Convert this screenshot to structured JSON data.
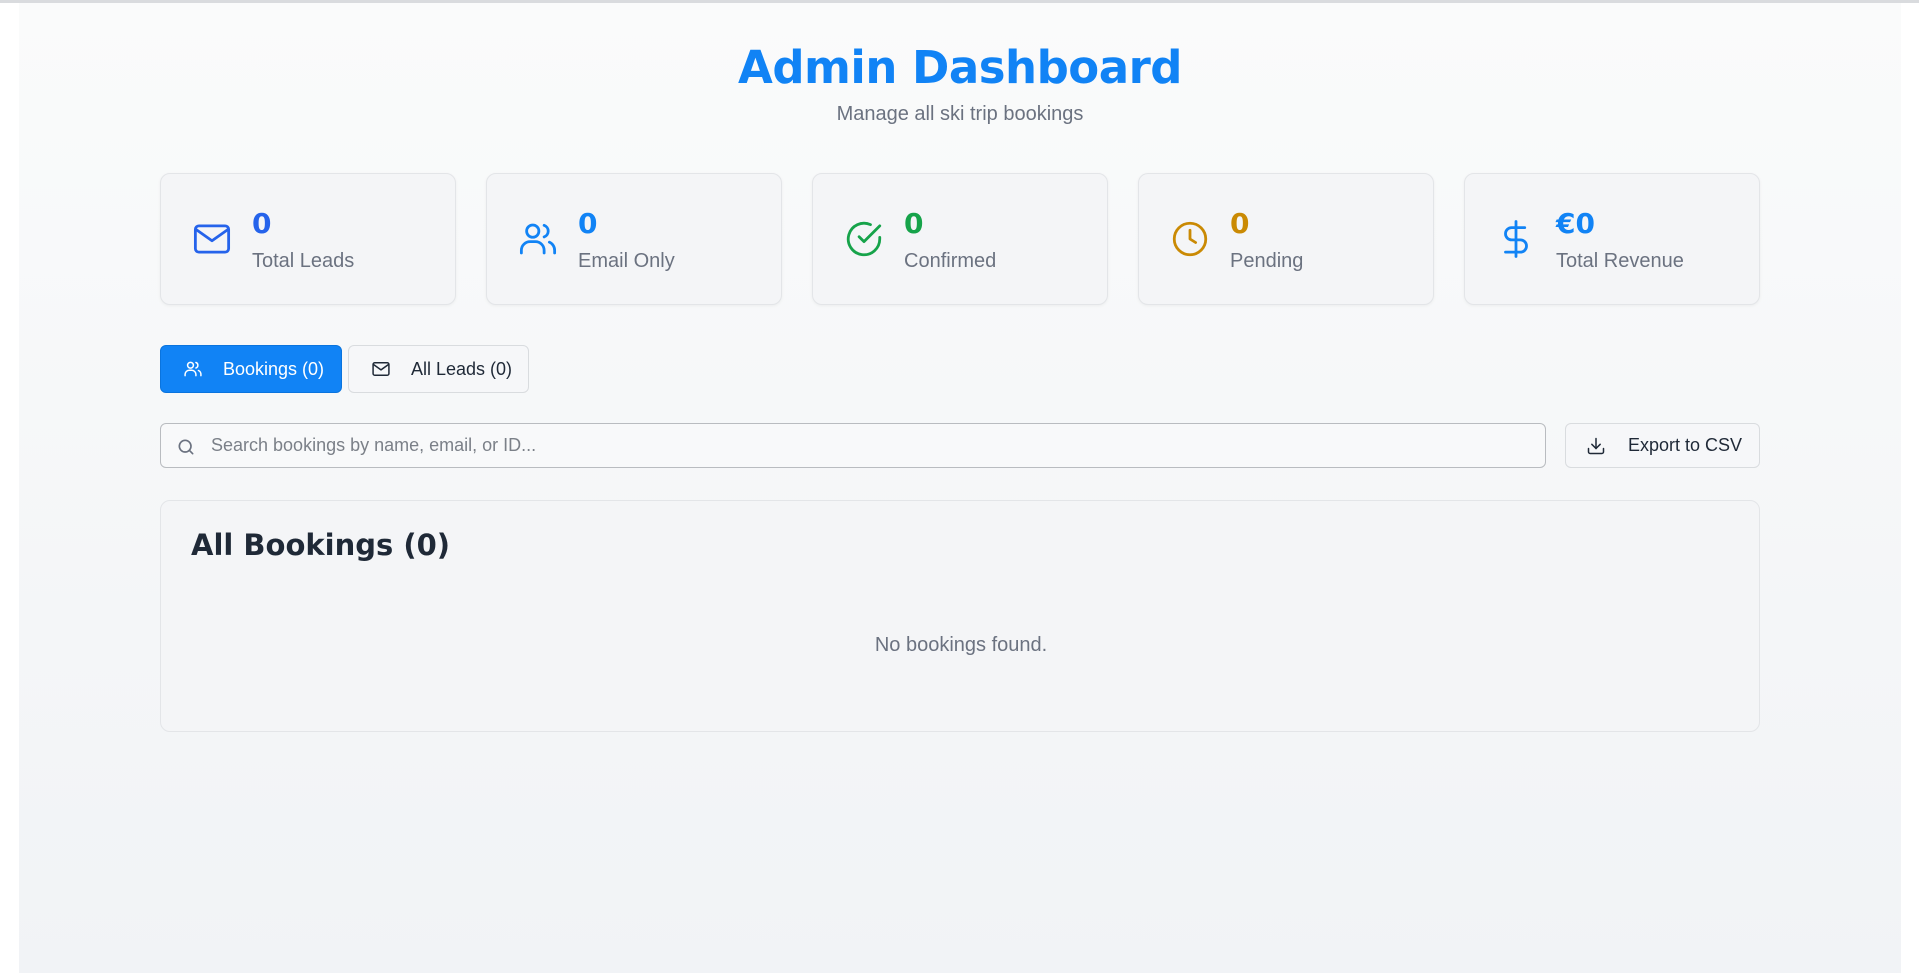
{
  "header": {
    "title": "Admin Dashboard",
    "subtitle": "Manage all ski trip bookings"
  },
  "stats": [
    {
      "icon": "mail-icon",
      "value": "0",
      "label": "Total Leads",
      "color": "#2563eb"
    },
    {
      "icon": "users-icon",
      "value": "0",
      "label": "Email Only",
      "color": "#1183f5"
    },
    {
      "icon": "check-circle-icon",
      "value": "0",
      "label": "Confirmed",
      "color": "#16a34a"
    },
    {
      "icon": "clock-icon",
      "value": "0",
      "label": "Pending",
      "color": "#ca8a04"
    },
    {
      "icon": "dollar-icon",
      "value": "€0",
      "label": "Total Revenue",
      "color": "#1183f5"
    }
  ],
  "tabs": [
    {
      "label": "Bookings (0)",
      "icon": "users-icon",
      "active": true
    },
    {
      "label": "All Leads (0)",
      "icon": "mail-icon",
      "active": false
    }
  ],
  "search": {
    "placeholder": "Search bookings by name, email, or ID...",
    "value": ""
  },
  "export_button": {
    "label": "Export to CSV",
    "icon": "download-icon"
  },
  "bookings_panel": {
    "title": "All Bookings (0)",
    "empty_message": "No bookings found."
  },
  "colors": {
    "accent": "#1183f5",
    "confirmed": "#16a34a",
    "pending": "#ca8a04",
    "leads": "#2563eb"
  }
}
